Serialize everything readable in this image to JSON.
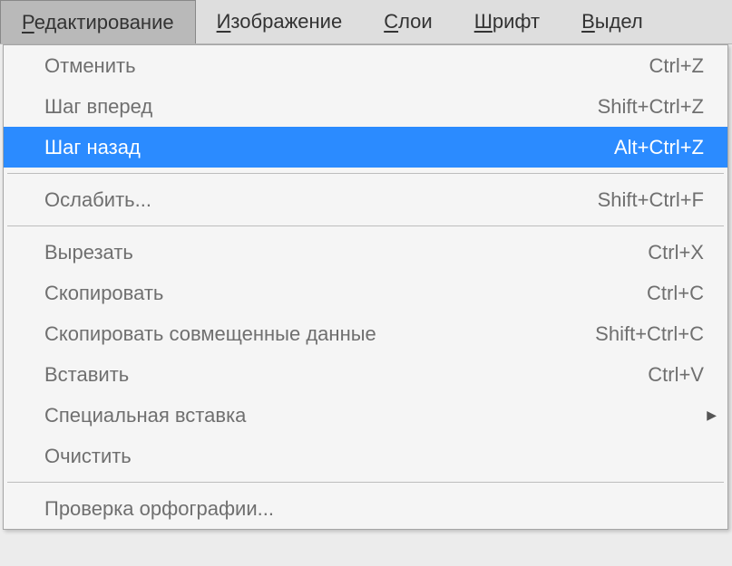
{
  "menubar": {
    "items": [
      {
        "label": "Редактирование",
        "u": 0,
        "active": true
      },
      {
        "label": "Изображение",
        "u": 0,
        "active": false
      },
      {
        "label": "Слои",
        "u": 0,
        "active": false
      },
      {
        "label": "Шрифт",
        "u": 0,
        "active": false
      },
      {
        "label": "Выдел",
        "u": 0,
        "active": false
      }
    ]
  },
  "dropdown": {
    "groups": [
      [
        {
          "label": "Отменить",
          "shortcut": "Ctrl+Z",
          "highlighted": false
        },
        {
          "label": "Шаг вперед",
          "shortcut": "Shift+Ctrl+Z",
          "highlighted": false
        },
        {
          "label": "Шаг назад",
          "shortcut": "Alt+Ctrl+Z",
          "highlighted": true
        }
      ],
      [
        {
          "label": "Ослабить...",
          "shortcut": "Shift+Ctrl+F",
          "highlighted": false
        }
      ],
      [
        {
          "label": "Вырезать",
          "shortcut": "Ctrl+X",
          "highlighted": false
        },
        {
          "label": "Скопировать",
          "shortcut": "Ctrl+C",
          "highlighted": false
        },
        {
          "label": "Скопировать совмещенные данные",
          "shortcut": "Shift+Ctrl+C",
          "highlighted": false
        },
        {
          "label": "Вставить",
          "shortcut": "Ctrl+V",
          "highlighted": false
        },
        {
          "label": "Специальная вставка",
          "shortcut": "",
          "submenu": true,
          "highlighted": false
        },
        {
          "label": "Очистить",
          "shortcut": "",
          "highlighted": false
        }
      ],
      [
        {
          "label": "Проверка орфографии...",
          "shortcut": "",
          "highlighted": false
        }
      ]
    ]
  }
}
